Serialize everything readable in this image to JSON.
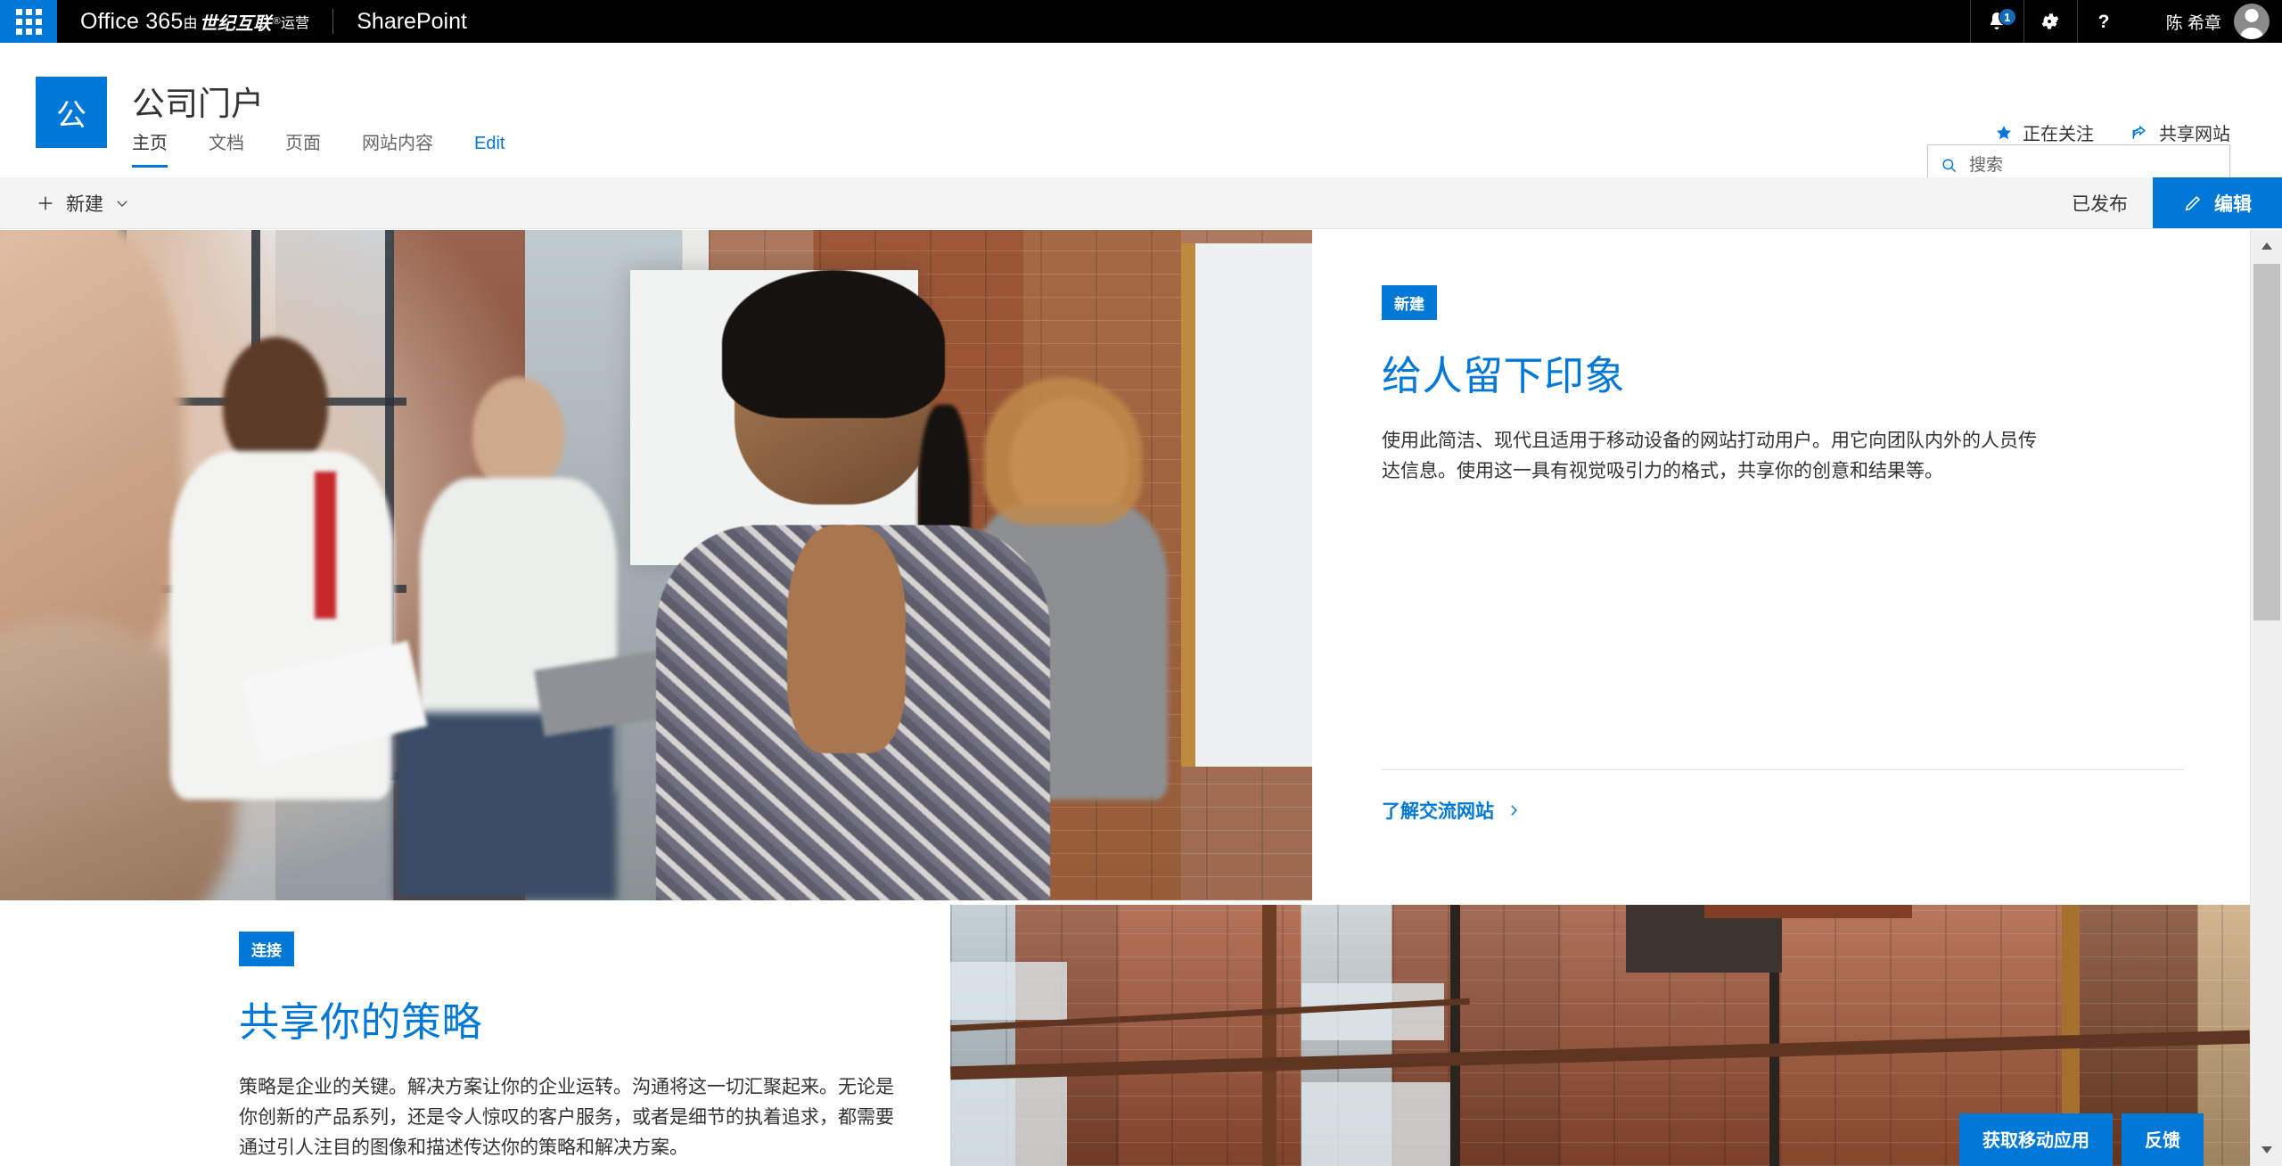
{
  "suitebar": {
    "app_launcher_icon": "waffle-grid-icon",
    "brand_prefix": "Office 365",
    "brand_cn_lead": "由",
    "brand_cn": "世纪互联",
    "brand_cn_mark": "®",
    "brand_cn_tail": "运营",
    "app_name": "SharePoint",
    "notifications_icon": "bell-icon",
    "notifications_count": "1",
    "settings_icon": "gear-icon",
    "help_icon": "question-mark-icon",
    "user_name": "陈 希章",
    "avatar_icon": "user-avatar-icon"
  },
  "site": {
    "logo_text": "公",
    "title": "公司门户",
    "nav": [
      {
        "label": "主页",
        "active": true
      },
      {
        "label": "文档",
        "active": false
      },
      {
        "label": "页面",
        "active": false
      },
      {
        "label": "网站内容",
        "active": false
      },
      {
        "label": "Edit",
        "active": false
      }
    ],
    "follow_label": "正在关注",
    "follow_icon": "star-icon",
    "share_label": "共享网站",
    "share_icon": "share-arrow-icon",
    "search_placeholder": "搜索",
    "search_value": "",
    "search_icon": "search-icon"
  },
  "commandbar": {
    "new_label": "新建",
    "new_icon": "plus-icon",
    "new_chevron_icon": "chevron-down-icon",
    "publish_status": "已发布",
    "edit_label": "编辑",
    "edit_icon": "pencil-icon"
  },
  "hero": {
    "badge": "新建",
    "title": "给人留下印象",
    "body": "使用此简洁、现代且适用于移动设备的网站打动用户。用它向团队内外的人员传达信息。使用这一具有视觉吸引力的格式，共享你的创意和结果等。",
    "link_label": "了解交流网站",
    "link_icon": "chevron-right-icon",
    "image_alt": "办公室会议人员照片"
  },
  "section_two": {
    "badge": "连接",
    "title": "共享你的策略",
    "body": "策略是企业的关键。解决方案让你的企业运转。沟通将这一切汇聚起来。无论是你创新的产品系列，还是令人惊叹的客户服务，或者是细节的执着追求，都需要通过引人注目的图像和描述传达你的策略和解决方案。",
    "image_alt": "砖墙与玻璃窗照片"
  },
  "floating": {
    "mobile_app_label": "获取移动应用",
    "feedback_label": "反馈"
  },
  "scrollbar": {
    "up_icon": "scroll-up-arrow-icon",
    "down_icon": "scroll-down-arrow-icon",
    "thumb_icon": "scroll-thumb"
  },
  "colors": {
    "accent": "#0078d7",
    "suitebar_bg": "#000000",
    "commandbar_bg": "#f4f4f4",
    "text": "#333333",
    "muted_text": "#666666"
  }
}
